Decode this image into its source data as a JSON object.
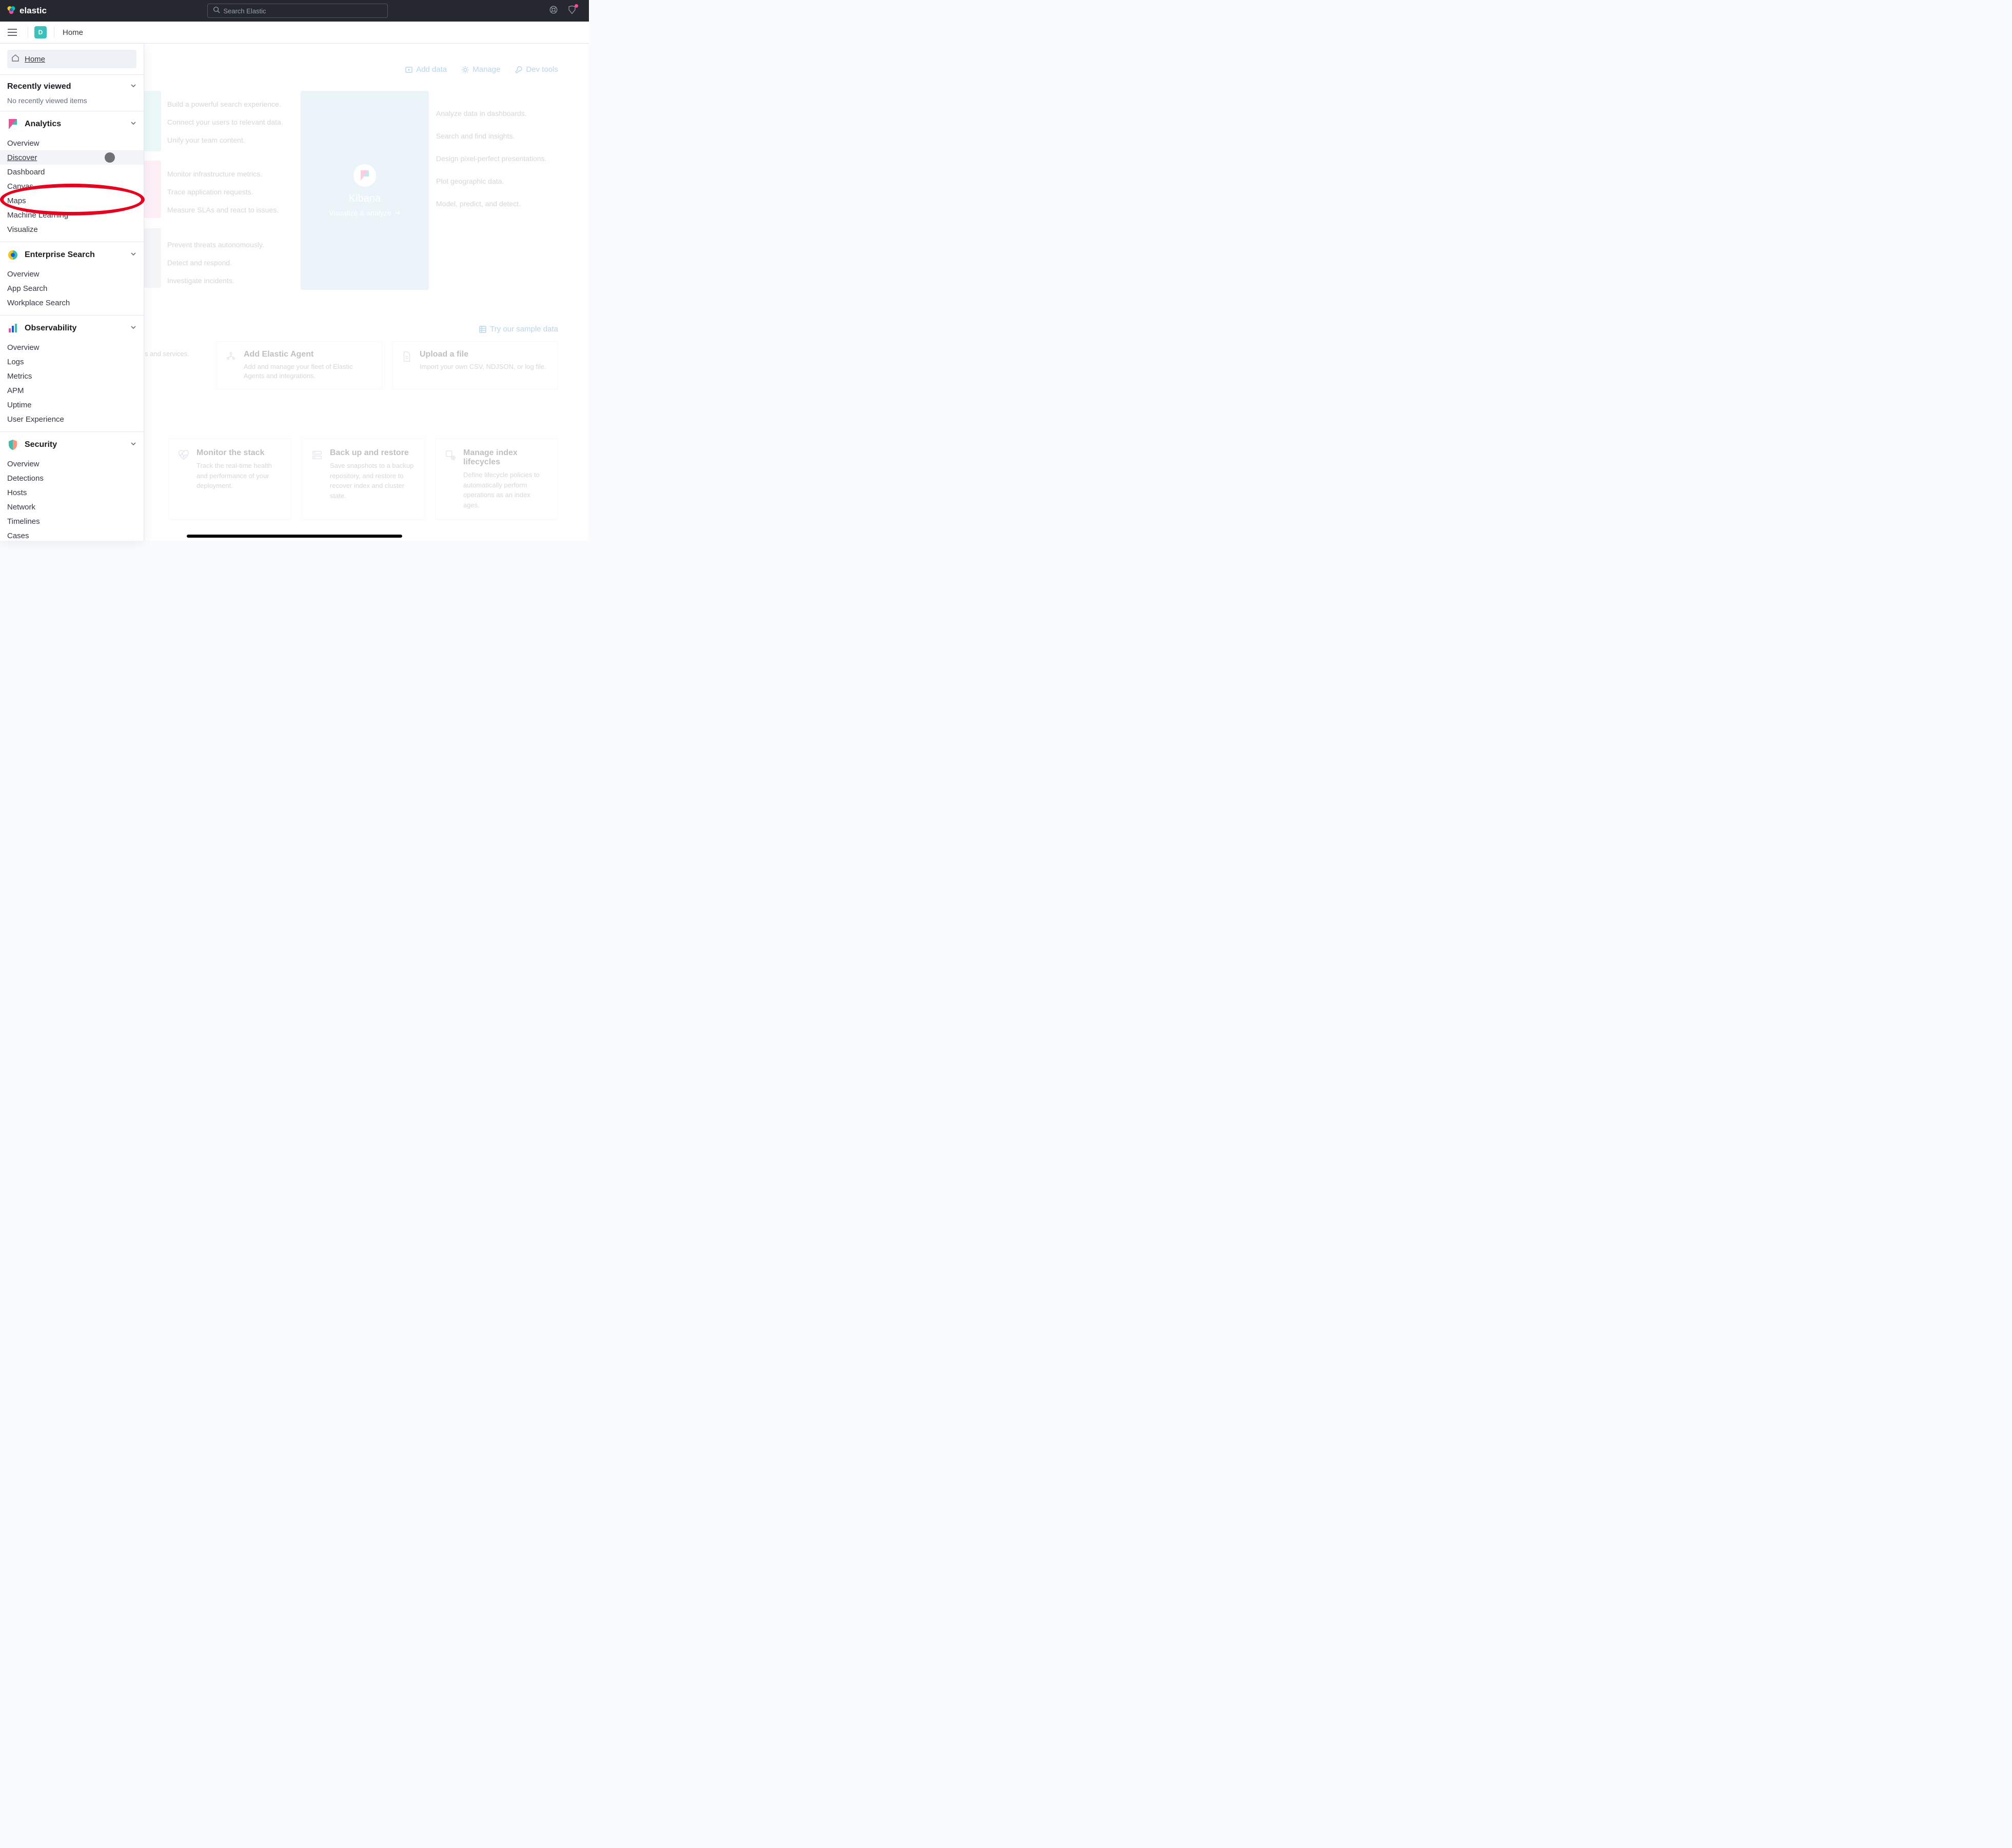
{
  "header": {
    "brand": "elastic",
    "searchPlaceholder": "Search Elastic"
  },
  "secondBar": {
    "badgeLetter": "D",
    "pageTitle": "Home"
  },
  "toolLinks": {
    "addData": "Add data",
    "manage": "Manage",
    "devTools": "Dev tools"
  },
  "featureCol": {
    "block1": [
      "Build a powerful search experience.",
      "Connect your users to relevant data.",
      "Unify your team content."
    ],
    "block2": [
      "Monitor infrastructure metrics.",
      "Trace application requests.",
      "Measure SLAs and react to issues."
    ],
    "block3": [
      "Prevent threats autonomously.",
      "Detect and respond.",
      "Investigate incidents."
    ]
  },
  "kibanaCard": {
    "title": "Kibana",
    "subtitle": "Visualize & analyze"
  },
  "kibanaSide": [
    "Analyze data in dashboards.",
    "Search and find insights.",
    "Design pixel-perfect presentations.",
    "Plot geographic data.",
    "Model, predict, and detect."
  ],
  "tryLink": "Try our sample data",
  "actionCards": {
    "partialText": "s and services.",
    "addAgent": {
      "title": "Add Elastic Agent",
      "desc": "Add and manage your fleet of Elastic Agents and integrations."
    },
    "upload": {
      "title": "Upload a file",
      "desc": "Import your own CSV, NDJSON, or log file."
    }
  },
  "mgmtCards": {
    "monitor": {
      "title": "Monitor the stack",
      "desc": "Track the real-time health and performance of your deployment."
    },
    "backup": {
      "title": "Back up and restore",
      "desc": "Save snapshots to a backup repository, and restore to recover index and cluster state."
    },
    "lifecycle": {
      "title": "Manage index lifecycles",
      "desc": "Define lifecycle policies to automatically perform operations as an index ages."
    }
  },
  "sideNav": {
    "home": "Home",
    "recentHead": "Recently viewed",
    "recentEmpty": "No recently viewed items",
    "analytics": {
      "head": "Analytics",
      "items": [
        "Overview",
        "Discover",
        "Dashboard",
        "Canvas",
        "Maps",
        "Machine Learning",
        "Visualize"
      ]
    },
    "enterprise": {
      "head": "Enterprise Search",
      "items": [
        "Overview",
        "App Search",
        "Workplace Search"
      ]
    },
    "observability": {
      "head": "Observability",
      "items": [
        "Overview",
        "Logs",
        "Metrics",
        "APM",
        "Uptime",
        "User Experience"
      ]
    },
    "security": {
      "head": "Security",
      "items": [
        "Overview",
        "Detections",
        "Hosts",
        "Network",
        "Timelines",
        "Cases"
      ]
    }
  }
}
